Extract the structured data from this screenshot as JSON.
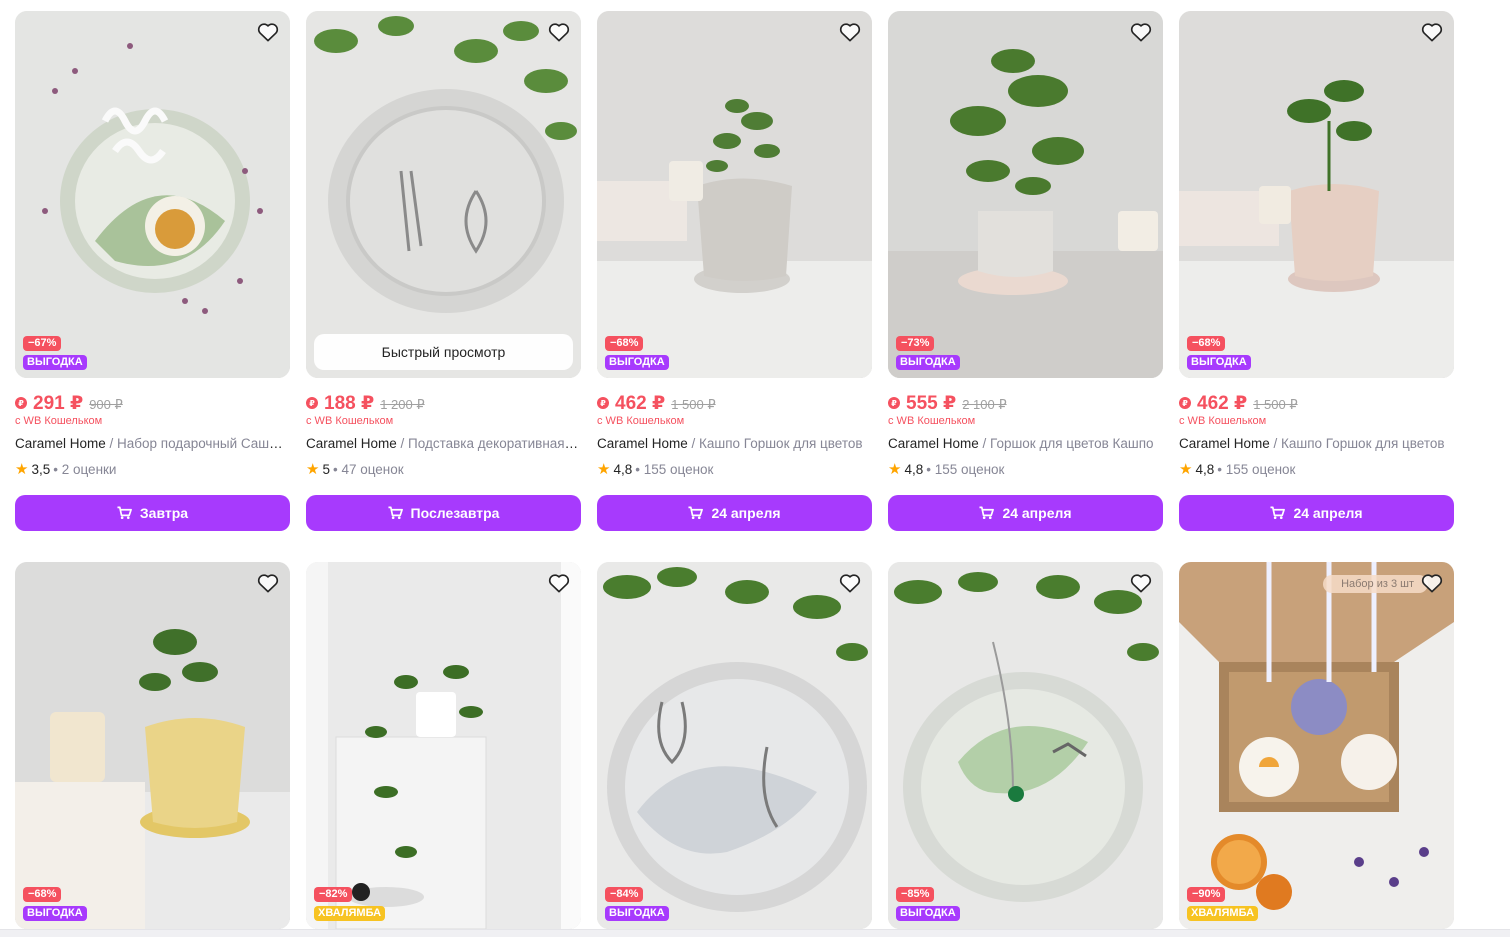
{
  "colors": {
    "accent": "#a73afd",
    "sale": "#f5515f",
    "muted": "#868695",
    "star": "#ffa500",
    "hvalamba": "#f7c322"
  },
  "icons": {
    "favorite": "heart-outline-icon",
    "cart": "cart-icon",
    "wallet": "wb-wallet-icon",
    "star": "star-icon"
  },
  "quick_view_label": "Быстрый просмотр",
  "products": [
    {
      "discount": "−67%",
      "label": "ВЫГОДКА",
      "price": "291 ₽",
      "old_price": "900 ₽",
      "wallet_note": "с WB Кошельком",
      "brand": "Caramel Home",
      "name": " / Набор подарочный Саше аромасаше",
      "rating": "3,5",
      "reviews": "• 2 оценки",
      "delivery": "Завтра"
    },
    {
      "discount": "",
      "label": "",
      "price": "188 ₽",
      "old_price": "1 200 ₽",
      "wallet_note": "с WB Кошельком",
      "brand": "Caramel Home",
      "name": " / Подставка декоративная для украшений",
      "rating": "5",
      "reviews": "• 47 оценок",
      "delivery": "Послезавтра"
    },
    {
      "discount": "−68%",
      "label": "ВЫГОДКА",
      "price": "462 ₽",
      "old_price": "1 500 ₽",
      "wallet_note": "с WB Кошельком",
      "brand": "Caramel Home",
      "name": " / Кашпо Горшок для цветов",
      "rating": "4,8",
      "reviews": "• 155 оценок",
      "delivery": "24 апреля"
    },
    {
      "discount": "−73%",
      "label": "ВЫГОДКА",
      "price": "555 ₽",
      "old_price": "2 100 ₽",
      "wallet_note": "с WB Кошельком",
      "brand": "Caramel Home",
      "name": " / Горшок для цветов Кашпо",
      "rating": "4,8",
      "reviews": "• 155 оценок",
      "delivery": "24 апреля"
    },
    {
      "discount": "−68%",
      "label": "ВЫГОДКА",
      "price": "462 ₽",
      "old_price": "1 500 ₽",
      "wallet_note": "с WB Кошельком",
      "brand": "Caramel Home",
      "name": " / Кашпо Горшок для цветов",
      "rating": "4,8",
      "reviews": "• 155 оценок",
      "delivery": "24 апреля"
    },
    {
      "discount": "−68%",
      "label": "ВЫГОДКА"
    },
    {
      "discount": "−82%",
      "label": "ХВАЛЯМБА"
    },
    {
      "discount": "−84%",
      "label": "ВЫГОДКА"
    },
    {
      "discount": "−85%",
      "label": "ВЫГОДКА"
    },
    {
      "discount": "−90%",
      "label": "ХВАЛЯМБА",
      "set_tag": "Набор из 3 шт"
    }
  ]
}
